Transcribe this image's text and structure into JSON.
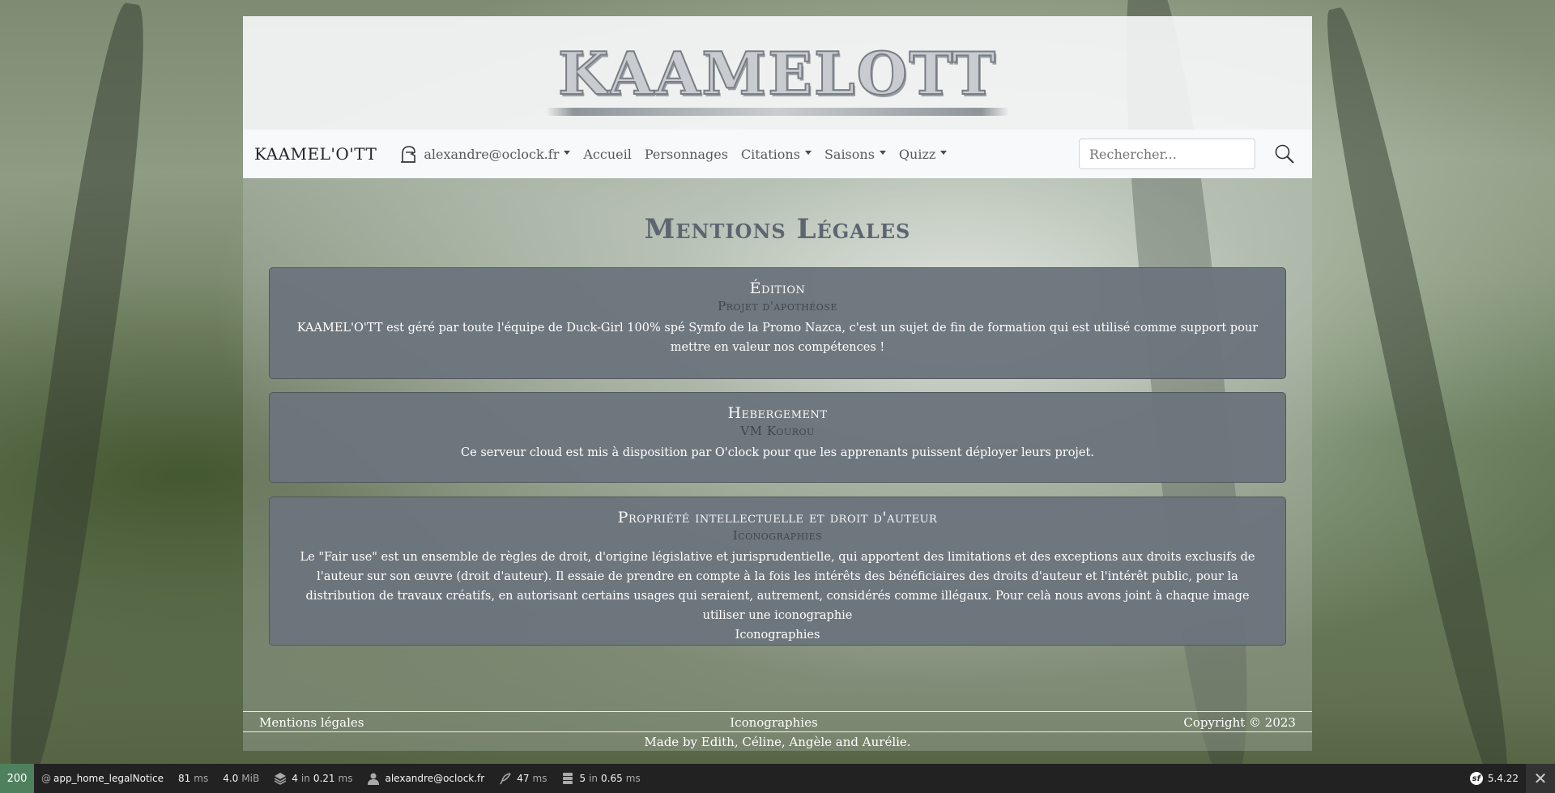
{
  "header": {
    "logo_text": "KAAMELOTT"
  },
  "navbar": {
    "brand": "KAAMEL'O'TT",
    "user": "alexandre@oclock.fr",
    "items": [
      {
        "label": "Accueil"
      },
      {
        "label": "Personnages"
      },
      {
        "label": "Citations"
      },
      {
        "label": "Saisons"
      },
      {
        "label": "Quizz"
      }
    ],
    "search_placeholder": "Rechercher..."
  },
  "main": {
    "title": "Mentions Légales",
    "cards": [
      {
        "title": "Édition",
        "subtitle": "Projet d'apothéose",
        "brand": "KAAMEL'O'TT",
        "text": " est géré par toute l'équipe de Duck-Girl 100% spé Symfo de la Promo Nazca, c'est un sujet de fin de formation qui est utilisé comme support pour mettre en valeur nos compétences !"
      },
      {
        "title": "Hebergement",
        "subtitle": "VM Kourou",
        "text": "Ce serveur cloud est mis à disposition par O'clock pour que les apprenants puissent déployer leurs projet."
      },
      {
        "title": "Propriété intellectuelle et droit d'auteur",
        "subtitle": "Iconographies",
        "text": "Le \"Fair use\" est un ensemble de règles de droit, d'origine législative et jurisprudentielle, qui apportent des limitations et des exceptions aux droits exclusifs de l'auteur sur son œuvre (droit d'auteur). Il essaie de prendre en compte à la fois les intérêts des bénéficiaires des droits d'auteur et l'intérêt public, pour la distribution de travaux créatifs, en autorisant certains usages qui seraient, autrement, considérés comme illégaux. Pour celà nous avons joint à chaque image utiliser une iconographie",
        "link": "Iconographies"
      }
    ]
  },
  "footer": {
    "left": "Mentions légales",
    "center": "Iconographies",
    "right": "Copyright © 2023",
    "made_by": "Made by Edith, Céline, Angèle and Aurélie."
  },
  "debug_toolbar": {
    "status": "200",
    "route": "app_home_legalNotice",
    "time_value": "81",
    "time_unit": "ms",
    "memory_value": "4.0",
    "memory_unit": "MiB",
    "twig_count": "4",
    "twig_in": "in",
    "twig_time": "0.21",
    "twig_unit": "ms",
    "user": "alexandre@oclock.fr",
    "perf_value": "47",
    "perf_unit": "ms",
    "db_count": "5",
    "db_in": "in",
    "db_time": "0.65",
    "db_unit": "ms",
    "version": "5.4.22"
  },
  "colors": {
    "card_bg": "#6c757d",
    "navbar_bg": "#f8f9fa",
    "toolbar_bg": "#222222",
    "status_green": "#4f805d",
    "title_color": "#5d6670"
  }
}
